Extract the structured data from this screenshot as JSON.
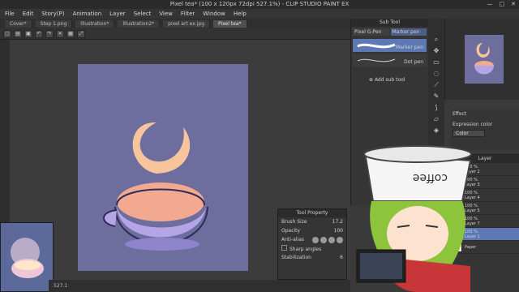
{
  "window": {
    "title": "Pixel tea* (100 x 120px 72dpi 527.1%) - CLIP STUDIO PAINT EX"
  },
  "menu": [
    "File",
    "Edit",
    "Story(P)",
    "Animation",
    "Layer",
    "Select",
    "View",
    "Filter",
    "Window",
    "Help"
  ],
  "tabs": [
    {
      "label": "Cover*",
      "active": false
    },
    {
      "label": "Step 1.png",
      "active": false
    },
    {
      "label": "Illustration*",
      "active": false
    },
    {
      "label": "Illustration2*",
      "active": false
    },
    {
      "label": "pixel art ex.jpg",
      "active": false
    },
    {
      "label": "Pixel tea*",
      "active": true
    }
  ],
  "subtool": {
    "panel_title": "Sub Tool",
    "tabs": [
      "Pixel G-Pen",
      "Marker pen"
    ],
    "items": [
      {
        "label": "Marker pen",
        "selected": true
      },
      {
        "label": "Dot pen",
        "selected": false
      }
    ],
    "add_label": "Add sub tool"
  },
  "tool_property": {
    "panel_title": "Tool Property",
    "brush_size_label": "Brush Size",
    "brush_size_value": "17.2",
    "opacity_label": "Opacity",
    "opacity_value": "100",
    "antialias_label": "Anti-alias",
    "sharp_angles_label": "Sharp angles",
    "stabilization_label": "Stabilization",
    "stabilization_value": "6"
  },
  "effect": {
    "title": "Effect",
    "expression_color_label": "Expression color",
    "expression_color_value": "Color"
  },
  "layers": {
    "panel_title": "Layer",
    "items": [
      {
        "opacity": "100 %",
        "blend": "Norm",
        "name": "Layer 2"
      },
      {
        "opacity": "100 %",
        "blend": "Norm",
        "name": "Layer 3"
      },
      {
        "opacity": "100 %",
        "blend": "Norm",
        "name": "Layer 4"
      },
      {
        "opacity": "100 %",
        "blend": "Norm",
        "name": "Layer 5"
      },
      {
        "opacity": "100 %",
        "blend": "Norm",
        "name": "Layer 7"
      },
      {
        "opacity": "100 %",
        "blend": "Norm",
        "name": "Layer 1"
      }
    ],
    "paper_label": "Paper"
  },
  "navigator": {
    "zoom": "527.1"
  },
  "overlay": {
    "cup_text": "coffee"
  },
  "colors": {
    "canvas_bg": "#6d6e9d",
    "accent": "#5c79b6",
    "moon": "#f7c49b",
    "tea": "#f2a98f",
    "cup": "#b4a6e6"
  }
}
